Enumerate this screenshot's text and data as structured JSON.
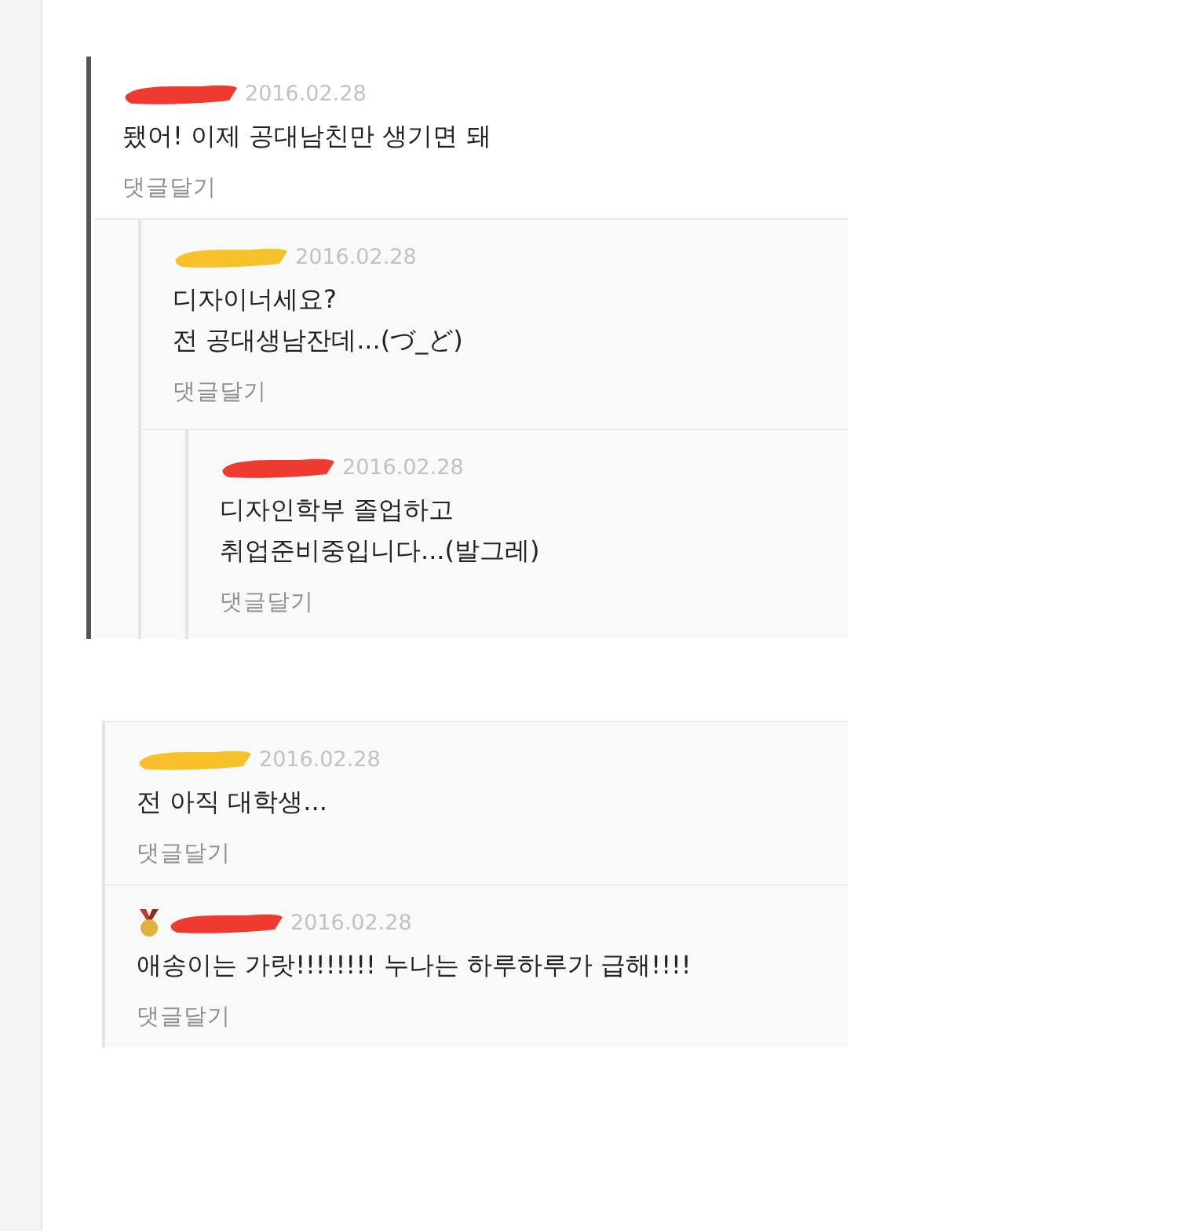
{
  "threads": [
    {
      "highlighted": true,
      "comments": [
        {
          "color": "#ee3a2f",
          "medal": false,
          "date": "2016.02.28",
          "lines": [
            "됐어! 이제 공대남친만 생기면 돼"
          ],
          "reply_label": "댓글달기",
          "children": [
            {
              "color": "#f7c12c",
              "medal": false,
              "date": "2016.02.28",
              "lines": [
                "디자이너세요?",
                "전 공대생남잔데...(づ_ど)"
              ],
              "reply_label": "댓글달기",
              "children": [
                {
                  "color": "#ee3a2f",
                  "medal": false,
                  "date": "2016.02.28",
                  "lines": [
                    "디자인학부 졸업하고",
                    "취업준비중입니다...(발그레)"
                  ],
                  "reply_label": "댓글달기"
                }
              ]
            }
          ]
        }
      ]
    },
    {
      "highlighted": false,
      "comments": [
        {
          "color": "#f7c12c",
          "medal": false,
          "date": "2016.02.28",
          "lines": [
            "전 아직 대학생..."
          ],
          "reply_label": "댓글달기"
        },
        {
          "color": "#ee3a2f",
          "medal": true,
          "date": "2016.02.28",
          "lines": [
            "애송이는 가랏!!!!!!!! 누나는 하루하루가 급해!!!!"
          ],
          "reply_label": "댓글달기"
        }
      ]
    }
  ]
}
